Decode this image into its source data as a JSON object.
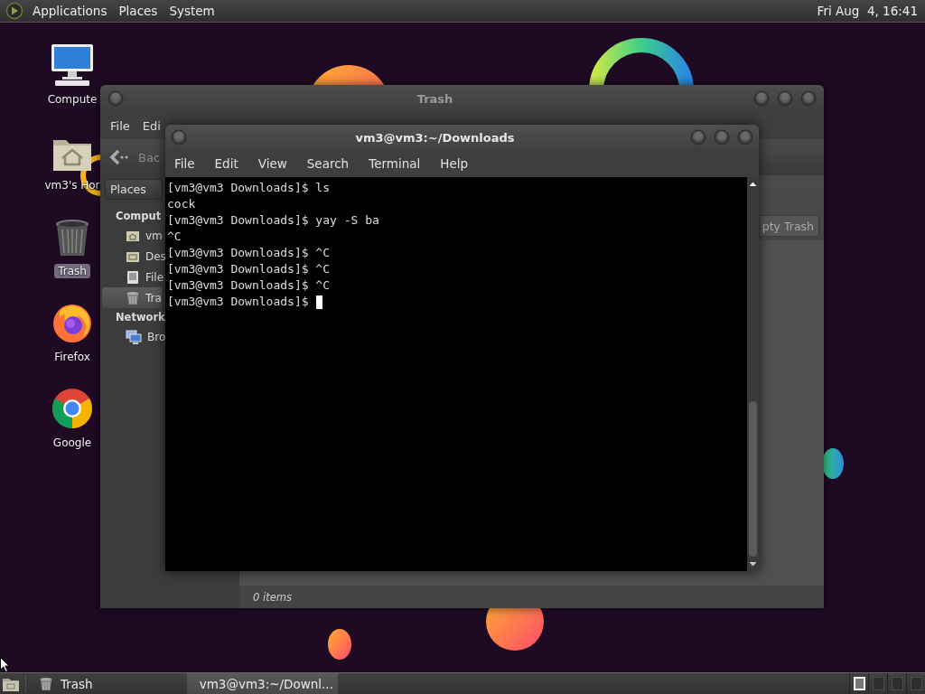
{
  "top_panel": {
    "menus": [
      "Applications",
      "Places",
      "System"
    ],
    "clock": "Fri Aug  4, 16:41"
  },
  "desktop_icons": [
    {
      "label": "Compute",
      "kind": "computer",
      "selected": false
    },
    {
      "label": "vm3's Hor",
      "kind": "home",
      "selected": false
    },
    {
      "label": "Trash",
      "kind": "trash",
      "selected": true
    },
    {
      "label": "Firefox",
      "kind": "firefox",
      "selected": false
    },
    {
      "label": "Google",
      "kind": "chrome",
      "selected": false
    }
  ],
  "file_manager": {
    "title": "Trash",
    "menus": [
      "File",
      "Edi"
    ],
    "back_button": "Bac",
    "places_selector": "Places",
    "sidebar": [
      {
        "heading": "Comput",
        "items": [
          {
            "label": "vm",
            "kind": "home",
            "selected": false
          },
          {
            "label": "Des",
            "kind": "desktop",
            "selected": false
          },
          {
            "label": "File",
            "kind": "drive",
            "selected": false
          },
          {
            "label": "Tra",
            "kind": "trash",
            "selected": true
          }
        ]
      },
      {
        "heading": "Network",
        "items": [
          {
            "label": "Bro",
            "kind": "network",
            "selected": false
          }
        ]
      }
    ],
    "empty_trash_button": "pty Trash",
    "status": "0 items"
  },
  "terminal": {
    "title": "vm3@vm3:~/Downloads",
    "menus": [
      "File",
      "Edit",
      "View",
      "Search",
      "Terminal",
      "Help"
    ],
    "lines": [
      "[vm3@vm3 Downloads]$ ls",
      "cock",
      "[vm3@vm3 Downloads]$ yay -S ba",
      "^C",
      "[vm3@vm3 Downloads]$ ^C",
      "[vm3@vm3 Downloads]$ ^C",
      "[vm3@vm3 Downloads]$ ^C",
      "[vm3@vm3 Downloads]$"
    ]
  },
  "taskbar": {
    "launchers": [
      {
        "label": "Trash",
        "kind": "trash"
      }
    ],
    "tasks": [
      {
        "label": "vm3@vm3:~/Downl...",
        "selected": true
      }
    ],
    "workspaces": [
      {
        "selected": true
      },
      {
        "selected": false
      },
      {
        "selected": false
      },
      {
        "selected": false
      }
    ]
  }
}
